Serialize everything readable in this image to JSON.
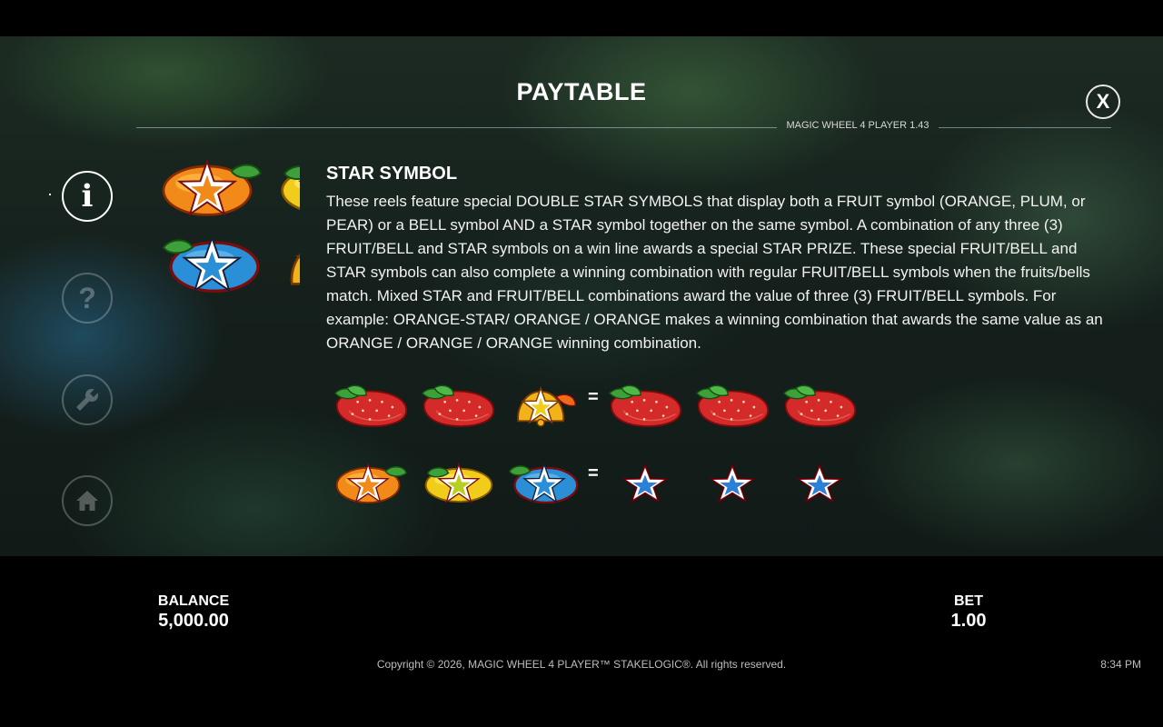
{
  "header": {
    "title": "PAYTABLE",
    "close_label": "X",
    "version": "MAGIC WHEEL 4 PLAYER 1.43"
  },
  "nav": {
    "items": [
      {
        "name": "info",
        "icon": "info-icon",
        "label": "i",
        "active": true
      },
      {
        "name": "help",
        "icon": "help-icon",
        "label": "?",
        "active": false
      },
      {
        "name": "settings",
        "icon": "wrench-icon",
        "active": false
      },
      {
        "name": "home",
        "icon": "home-icon",
        "active": false
      }
    ]
  },
  "section": {
    "title": "STAR SYMBOL",
    "text": "These reels feature special DOUBLE STAR SYMBOLS that display both a FRUIT symbol (ORANGE, PLUM, or PEAR) or a BELL symbol AND a STAR symbol together on the same symbol. A combination of any three (3) FRUIT/BELL and STAR symbols on a win line awards a special STAR PRIZE. These special FRUIT/BELL and STAR symbols can also complete a winning combination with regular FRUIT/BELL symbols when the fruits/bells match. Mixed STAR and FRUIT/BELL combinations award the value of three (3) FRUIT/BELL symbols. For example: ORANGE-STAR/ ORANGE / ORANGE makes a winning combination that awards the same value as an ORANGE / ORANGE / ORANGE winning combination."
  },
  "examples": {
    "equals": "=",
    "row1": {
      "left": [
        "strawberry-symbol",
        "strawberry-symbol",
        "bell-star-symbol"
      ],
      "right": [
        "strawberry-symbol",
        "strawberry-symbol",
        "strawberry-symbol"
      ]
    },
    "row2": {
      "left": [
        "orange-star-symbol",
        "lemon-star-symbol",
        "plum-star-symbol"
      ],
      "right": [
        "blue-star-symbol",
        "blue-star-symbol",
        "blue-star-symbol"
      ]
    }
  },
  "footer": {
    "balance_label": "BALANCE",
    "balance_value": "5,000.00",
    "bet_label": "BET",
    "bet_value": "1.00",
    "copyright": "Copyright © 2026, MAGIC WHEEL 4 PLAYER™ STAKELOGIC®. All rights reserved.",
    "clock": "8:34 PM"
  },
  "colors": {
    "orange": "#f28a1a",
    "star_blue": "#2a8fd6",
    "strawberry": "#d42a2a",
    "leaf": "#3ea03a",
    "lemon": "#f2cc1a"
  }
}
